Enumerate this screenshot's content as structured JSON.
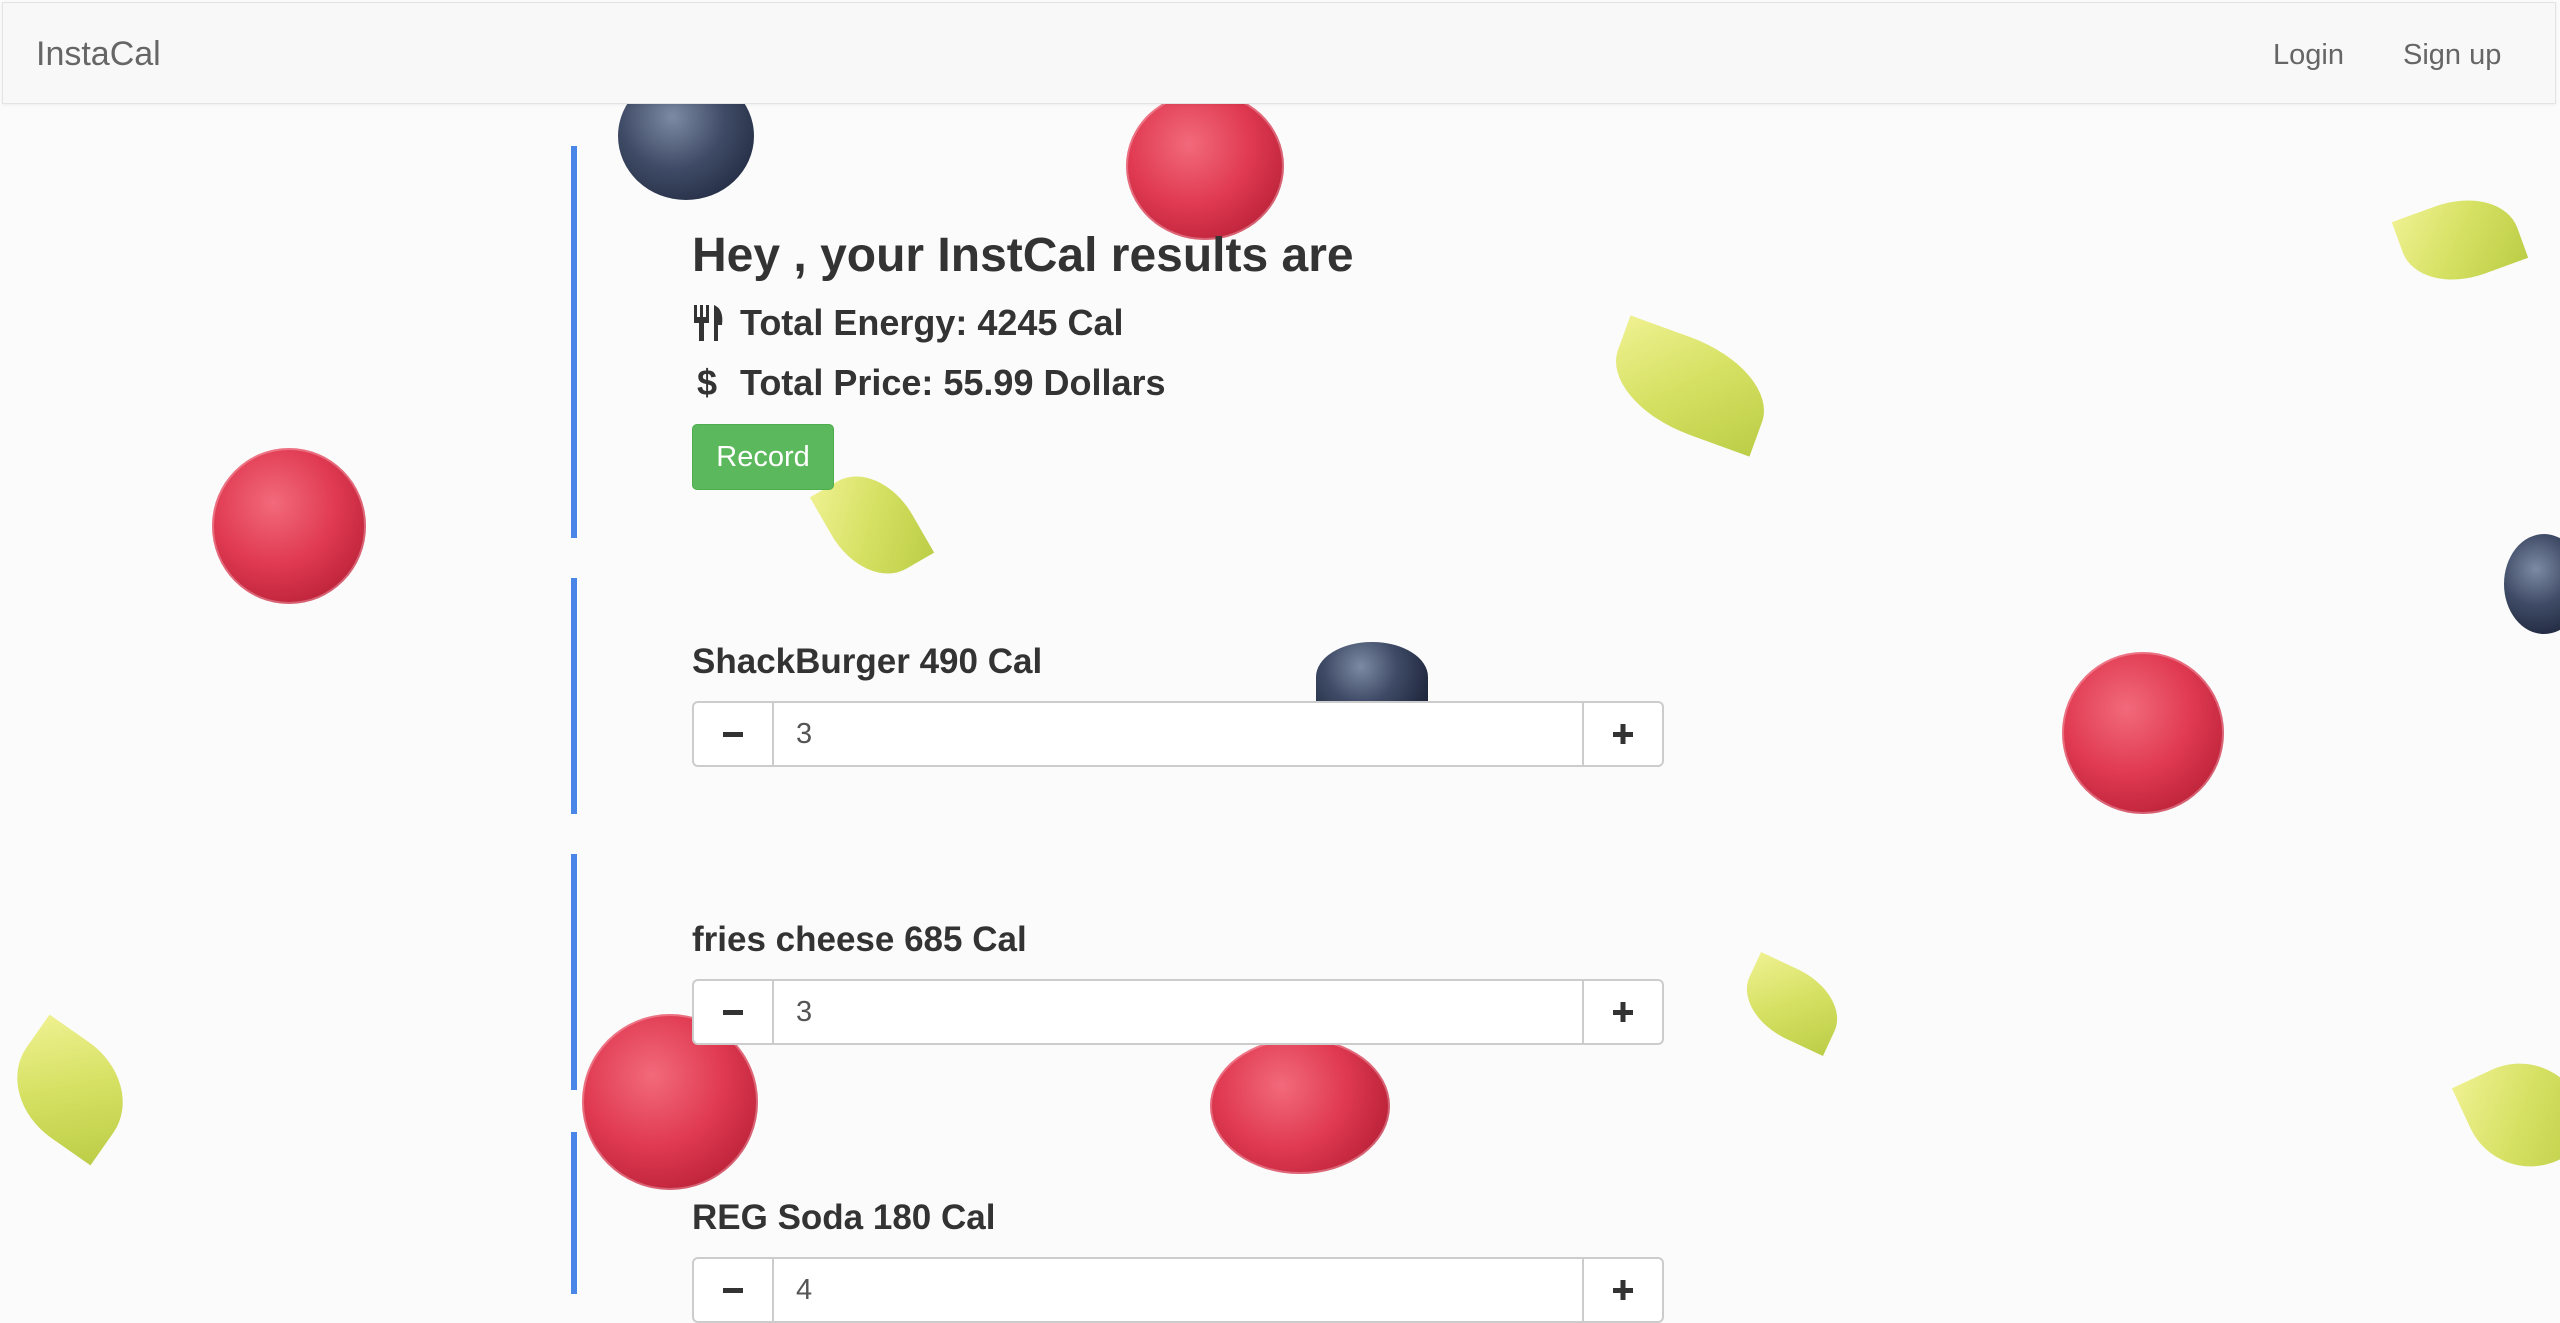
{
  "navbar": {
    "brand": "InstaCal",
    "login_label": "Login",
    "signup_label": "Sign up"
  },
  "results": {
    "title": "Hey , your InstCal results are",
    "energy_text": "Total Energy: 4245 Cal",
    "price_text": "Total Price: 55.99 Dollars",
    "record_label": "Record",
    "icons": {
      "energy": "cutlery-icon",
      "price": "dollar-icon"
    }
  },
  "items": [
    {
      "label": "ShackBurger 490 Cal",
      "quantity": "3"
    },
    {
      "label": "fries cheese 685 Cal",
      "quantity": "3"
    },
    {
      "label": "REG Soda 180 Cal",
      "quantity": "4"
    }
  ],
  "colors": {
    "accent": "#4a86e8",
    "record_button": "#5cb85c",
    "navbar_bg": "#f8f8f8"
  }
}
